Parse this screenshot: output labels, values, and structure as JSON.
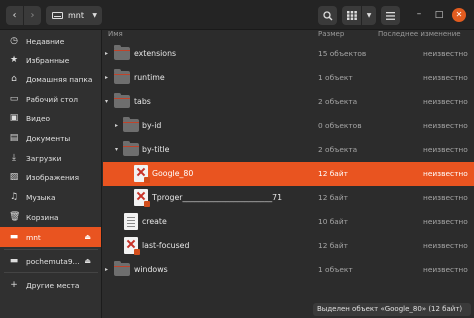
{
  "header": {
    "back_glyph": "‹",
    "forward_glyph": "›",
    "location_label": "mnt",
    "search_glyph": "🔍",
    "view_glyph": "⊞",
    "menu_glyph": "≡",
    "minimize_glyph": "–",
    "maximize_glyph": "□",
    "close_glyph": "✕"
  },
  "columns": {
    "name": "Имя",
    "size": "Размер",
    "modified": "Последнее изменение"
  },
  "sidebar": {
    "items": [
      {
        "label": "Недавние",
        "icon": "clock-icon",
        "glyph": "◷"
      },
      {
        "label": "Избранные",
        "icon": "star-icon",
        "glyph": "★"
      },
      {
        "label": "Домашняя папка",
        "icon": "home-icon",
        "glyph": "⌂"
      },
      {
        "label": "Рабочий стол",
        "icon": "desktop-icon",
        "glyph": "▭"
      },
      {
        "label": "Видео",
        "icon": "video-icon",
        "glyph": "▣"
      },
      {
        "label": "Документы",
        "icon": "document-icon",
        "glyph": "▤"
      },
      {
        "label": "Загрузки",
        "icon": "download-icon",
        "glyph": "⤓"
      },
      {
        "label": "Изображения",
        "icon": "image-icon",
        "glyph": "▨"
      },
      {
        "label": "Музыка",
        "icon": "music-icon",
        "glyph": "♫"
      },
      {
        "label": "Корзина",
        "icon": "trash-icon",
        "glyph": "🗑"
      },
      {
        "label": "mnt",
        "icon": "drive-icon",
        "glyph": "▬"
      },
      {
        "label": "pochemuta9...",
        "icon": "drive-icon",
        "glyph": "▬"
      },
      {
        "label": "Другие места",
        "icon": "plus-icon",
        "glyph": "+"
      }
    ],
    "eject_glyph": "⏏"
  },
  "files": [
    {
      "name": "extensions",
      "size": "15 объектов",
      "modified": "неизвестно"
    },
    {
      "name": "runtime",
      "size": "1 объект",
      "modified": "неизвестно"
    },
    {
      "name": "tabs",
      "size": "2 объекта",
      "modified": "неизвестно"
    },
    {
      "name": "by-id",
      "size": "0 объектов",
      "modified": "неизвестно"
    },
    {
      "name": "by-title",
      "size": "2 объекта",
      "modified": "неизвестно"
    },
    {
      "name": "Google_80",
      "size": "12 байт",
      "modified": "неизвестно"
    },
    {
      "name": "Tproger_______________________71",
      "size": "12 байт",
      "modified": "неизвестно"
    },
    {
      "name": "create",
      "size": "10 байт",
      "modified": "неизвестно"
    },
    {
      "name": "last-focused",
      "size": "12 байт",
      "modified": "неизвестно"
    },
    {
      "name": "windows",
      "size": "1 объект",
      "modified": "неизвестно"
    }
  ],
  "tree": {
    "collapsed_glyph": "▸",
    "expanded_glyph": "▾"
  },
  "status": "Выделен объект «Google_80» (12 байт)",
  "colors": {
    "accent": "#e95420",
    "background": "#2c2c2c",
    "sidebar": "#303030"
  }
}
